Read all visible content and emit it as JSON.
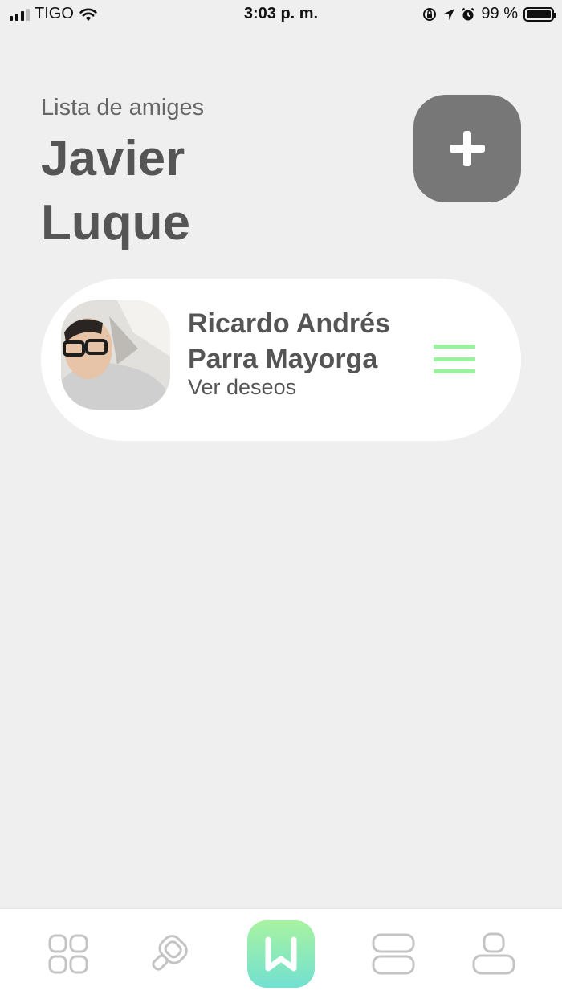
{
  "status_bar": {
    "carrier": "TIGO",
    "time": "3:03 p. m.",
    "battery_text": "99 %",
    "battery_level": 0.99
  },
  "header": {
    "subtitle": "Lista de amiges",
    "owner_name": "Javier Luque"
  },
  "add_button": {
    "icon": "plus-icon"
  },
  "friends": [
    {
      "name": "Ricardo Andrés Parra Mayorga",
      "link_text": "Ver deseos",
      "menu_icon": "hamburger-icon",
      "menu_color": "#9af29f"
    }
  ],
  "bottom_nav": {
    "items": [
      {
        "icon": "grid-icon"
      },
      {
        "icon": "search-icon"
      },
      {
        "icon": "wishlist-logo-icon",
        "active": true
      },
      {
        "icon": "list-icon"
      },
      {
        "icon": "profile-icon"
      }
    ]
  },
  "colors": {
    "background": "#efefef",
    "card": "#ffffff",
    "accent_green": "#9af29f",
    "accent_gradient_end": "#72e0d2",
    "button_gray": "#777777",
    "text": "#555555"
  }
}
